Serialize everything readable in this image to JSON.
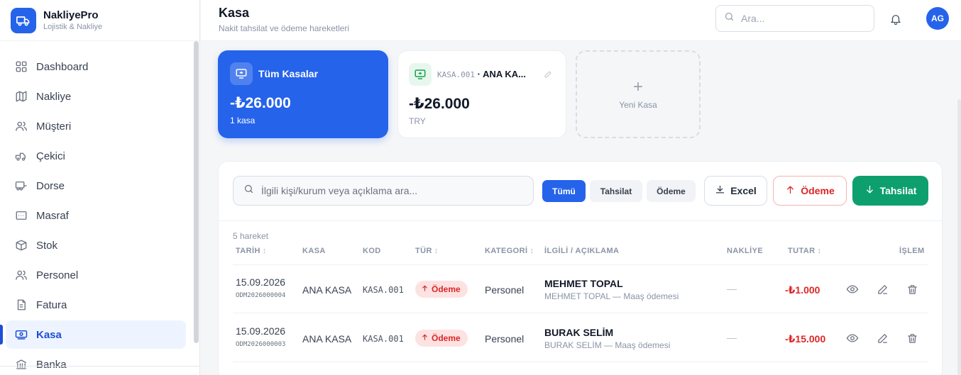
{
  "brand": {
    "name": "NakliyePro",
    "subtitle": "Lojistik & Nakliye"
  },
  "sidebar": {
    "items": [
      {
        "label": "Dashboard",
        "icon": "grid-icon"
      },
      {
        "label": "Nakliye",
        "icon": "map-icon"
      },
      {
        "label": "Müşteri",
        "icon": "users-icon"
      },
      {
        "label": "Çekici",
        "icon": "truck-icon"
      },
      {
        "label": "Dorse",
        "icon": "trailer-icon"
      },
      {
        "label": "Masraf",
        "icon": "receipt-icon"
      },
      {
        "label": "Stok",
        "icon": "box-icon"
      },
      {
        "label": "Personel",
        "icon": "users-icon"
      },
      {
        "label": "Fatura",
        "icon": "invoice-icon"
      },
      {
        "label": "Kasa",
        "icon": "cash-register-icon",
        "active": true
      },
      {
        "label": "Banka",
        "icon": "bank-icon"
      }
    ]
  },
  "header": {
    "title": "Kasa",
    "subtitle": "Nakit tahsilat ve ödeme hareketleri",
    "search_placeholder": "Ara...",
    "avatar_initials": "AG"
  },
  "cards": {
    "all": {
      "title": "Tüm Kasalar",
      "amount": "-₺26.000",
      "sub": "1 kasa"
    },
    "kasa": {
      "code": "KASA.001",
      "separator": " · ",
      "name": "ANA KA...",
      "amount": "-₺26.000",
      "currency": "TRY"
    },
    "new": {
      "plus": "+",
      "label": "Yeni Kasa"
    }
  },
  "toolbar": {
    "search_placeholder": "İlgili kişi/kurum veya açıklama ara...",
    "filters": {
      "all": "Tümü",
      "tahsilat": "Tahsilat",
      "odeme": "Ödeme"
    },
    "excel_label": "Excel",
    "odeme_label": "Ödeme",
    "tahsilat_label": "Tahsilat"
  },
  "table": {
    "count_label": "5 hareket",
    "sort_glyph": "↕",
    "columns": {
      "tarih": "TARİH",
      "kasa": "KASA",
      "kod": "KOD",
      "tur": "TÜR",
      "kategori": "KATEGORİ",
      "ilgili": "İLGİLİ / AÇIKLAMA",
      "nakliye": "NAKLİYE",
      "tutar": "TUTAR",
      "islem": "İŞLEM"
    },
    "rows": [
      {
        "date": "15.09.2026",
        "doc_no": "ODM2026000004",
        "kasa": "ANA KASA",
        "kod": "KASA.001",
        "tur": "Ödeme",
        "kategori": "Personel",
        "ilgili": "MEHMET TOPAL",
        "aciklama": "MEHMET TOPAL — Maaş ödemesi",
        "nakliye": "—",
        "tutar": "-₺1.000"
      },
      {
        "date": "15.09.2026",
        "doc_no": "ODM2026000003",
        "kasa": "ANA KASA",
        "kod": "KASA.001",
        "tur": "Ödeme",
        "kategori": "Personel",
        "ilgili": "BURAK SELİM",
        "aciklama": "BURAK SELİM — Maaş ödemesi",
        "nakliye": "—",
        "tutar": "-₺15.000"
      }
    ]
  },
  "colors": {
    "accent": "#2563eb",
    "success": "#0e9f6e",
    "danger": "#dc2626"
  }
}
